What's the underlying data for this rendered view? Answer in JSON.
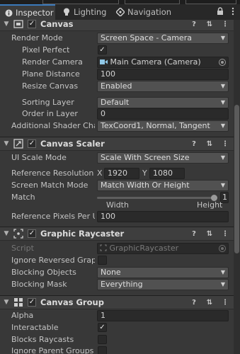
{
  "tabs": {
    "inspector": "Inspector",
    "lighting": "Lighting",
    "navigation": "Navigation"
  },
  "canvas": {
    "title": "Canvas",
    "render_mode_label": "Render Mode",
    "render_mode_value": "Screen Space - Camera",
    "pixel_perfect_label": "Pixel Perfect",
    "render_camera_label": "Render Camera",
    "render_camera_value": "Main Camera (Camera)",
    "plane_distance_label": "Plane Distance",
    "plane_distance_value": "100",
    "resize_canvas_label": "Resize Canvas",
    "resize_canvas_value": "Enabled",
    "sorting_layer_label": "Sorting Layer",
    "sorting_layer_value": "Default",
    "order_in_layer_label": "Order in Layer",
    "order_in_layer_value": "0",
    "shader_channels_label": "Additional Shader Chann",
    "shader_channels_value": "TexCoord1, Normal, Tangent"
  },
  "canvas_scaler": {
    "title": "Canvas Scaler",
    "ui_scale_mode_label": "UI Scale Mode",
    "ui_scale_mode_value": "Scale With Screen Size",
    "ref_resolution_label": "Reference Resolution",
    "x_label": "X",
    "x_value": "1920",
    "y_label": "Y",
    "y_value": "1080",
    "screen_match_label": "Screen Match Mode",
    "screen_match_value": "Match Width Or Height",
    "match_label": "Match",
    "match_value": "1",
    "match_fraction": 1,
    "width_label": "Width",
    "height_label": "Height",
    "ref_pixels_label": "Reference Pixels Per Un",
    "ref_pixels_value": "100"
  },
  "graphic_raycaster": {
    "title": "Graphic Raycaster",
    "script_label": "Script",
    "script_value": "GraphicRaycaster",
    "ignore_reversed_label": "Ignore Reversed Graphic",
    "blocking_objects_label": "Blocking Objects",
    "blocking_objects_value": "None",
    "blocking_mask_label": "Blocking Mask",
    "blocking_mask_value": "Everything"
  },
  "canvas_group": {
    "title": "Canvas Group",
    "alpha_label": "Alpha",
    "alpha_value": "1",
    "interactable_label": "Interactable",
    "blocks_raycasts_label": "Blocks Raycasts",
    "ignore_parent_label": "Ignore Parent Groups"
  },
  "checkbox_checked_glyph": "✓",
  "colors": {
    "background": "#383838",
    "field": "#2a2a2a",
    "dropdown": "#515151",
    "header": "#3e3e3e",
    "active_tab_accent": "#3a79bb"
  }
}
